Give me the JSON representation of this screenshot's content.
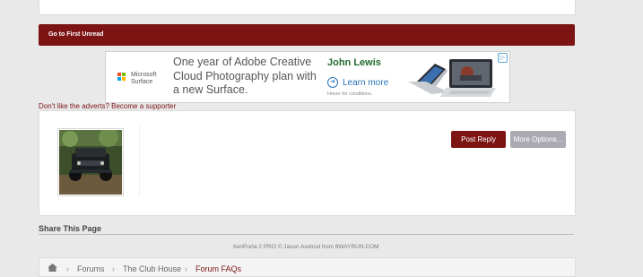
{
  "first_unread": {
    "label": "Go to First Unread"
  },
  "ad": {
    "adchoices_icon": "adchoices-icon",
    "advertiser_logo": "microsoft-logo",
    "logo_colors": [
      "#f25022",
      "#7fba00",
      "#00a4ef",
      "#ffb900"
    ],
    "advertiser_line1": "Microsoft",
    "advertiser_line2": "Surface",
    "headline": "One year of Adobe Creative Cloud Photography plan with a new Surface.",
    "store": "John Lewis",
    "cta": "Learn more",
    "disclaimer": "Hover for conditions."
  },
  "adverts_link": "Don't like the adverts? Become a supporter",
  "reply": {
    "post_reply_label": "Post Reply",
    "more_options_label": "More Options..."
  },
  "share": {
    "title": "Share This Page"
  },
  "footer": {
    "credit": "XenPorta 2 PRO © Jason Axelrod from 8WAYRUN.COM"
  },
  "breadcrumb": {
    "items": [
      "Forums",
      "The Club House",
      "Forum FAQs"
    ]
  },
  "colors": {
    "accent": "#7d1414",
    "secondary_button": "#a9aab2",
    "page_background": "#e9e9e9"
  }
}
